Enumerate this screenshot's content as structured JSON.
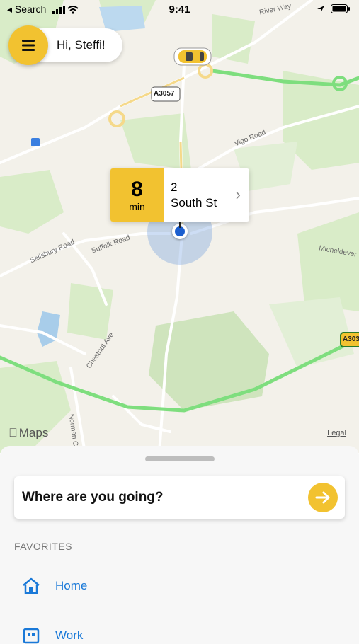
{
  "status_bar": {
    "back_label": "◂ Search",
    "time": "9:41"
  },
  "greeting": {
    "text": "Hi, Steffi!"
  },
  "map": {
    "road_labels": [
      "River Way",
      "A3057",
      "Vigo Road",
      "Salisbury Road",
      "Suffolk Road",
      "Chestnut Ave",
      "Norman Co",
      "Micheldever",
      "A303"
    ],
    "attribution": "Maps",
    "legal": "Legal"
  },
  "eta_card": {
    "minutes": "8",
    "unit": "min",
    "address_line1": "2",
    "address_line2": "South St"
  },
  "sheet": {
    "search_label": "Where are you going?",
    "favorites_header": "FAVORITES",
    "favorites": [
      {
        "label": "Home",
        "icon": "home-icon"
      },
      {
        "label": "Work",
        "icon": "work-icon"
      }
    ]
  },
  "colors": {
    "accent": "#f2c230",
    "link": "#1a79d8",
    "highway": "#7ede7e"
  }
}
